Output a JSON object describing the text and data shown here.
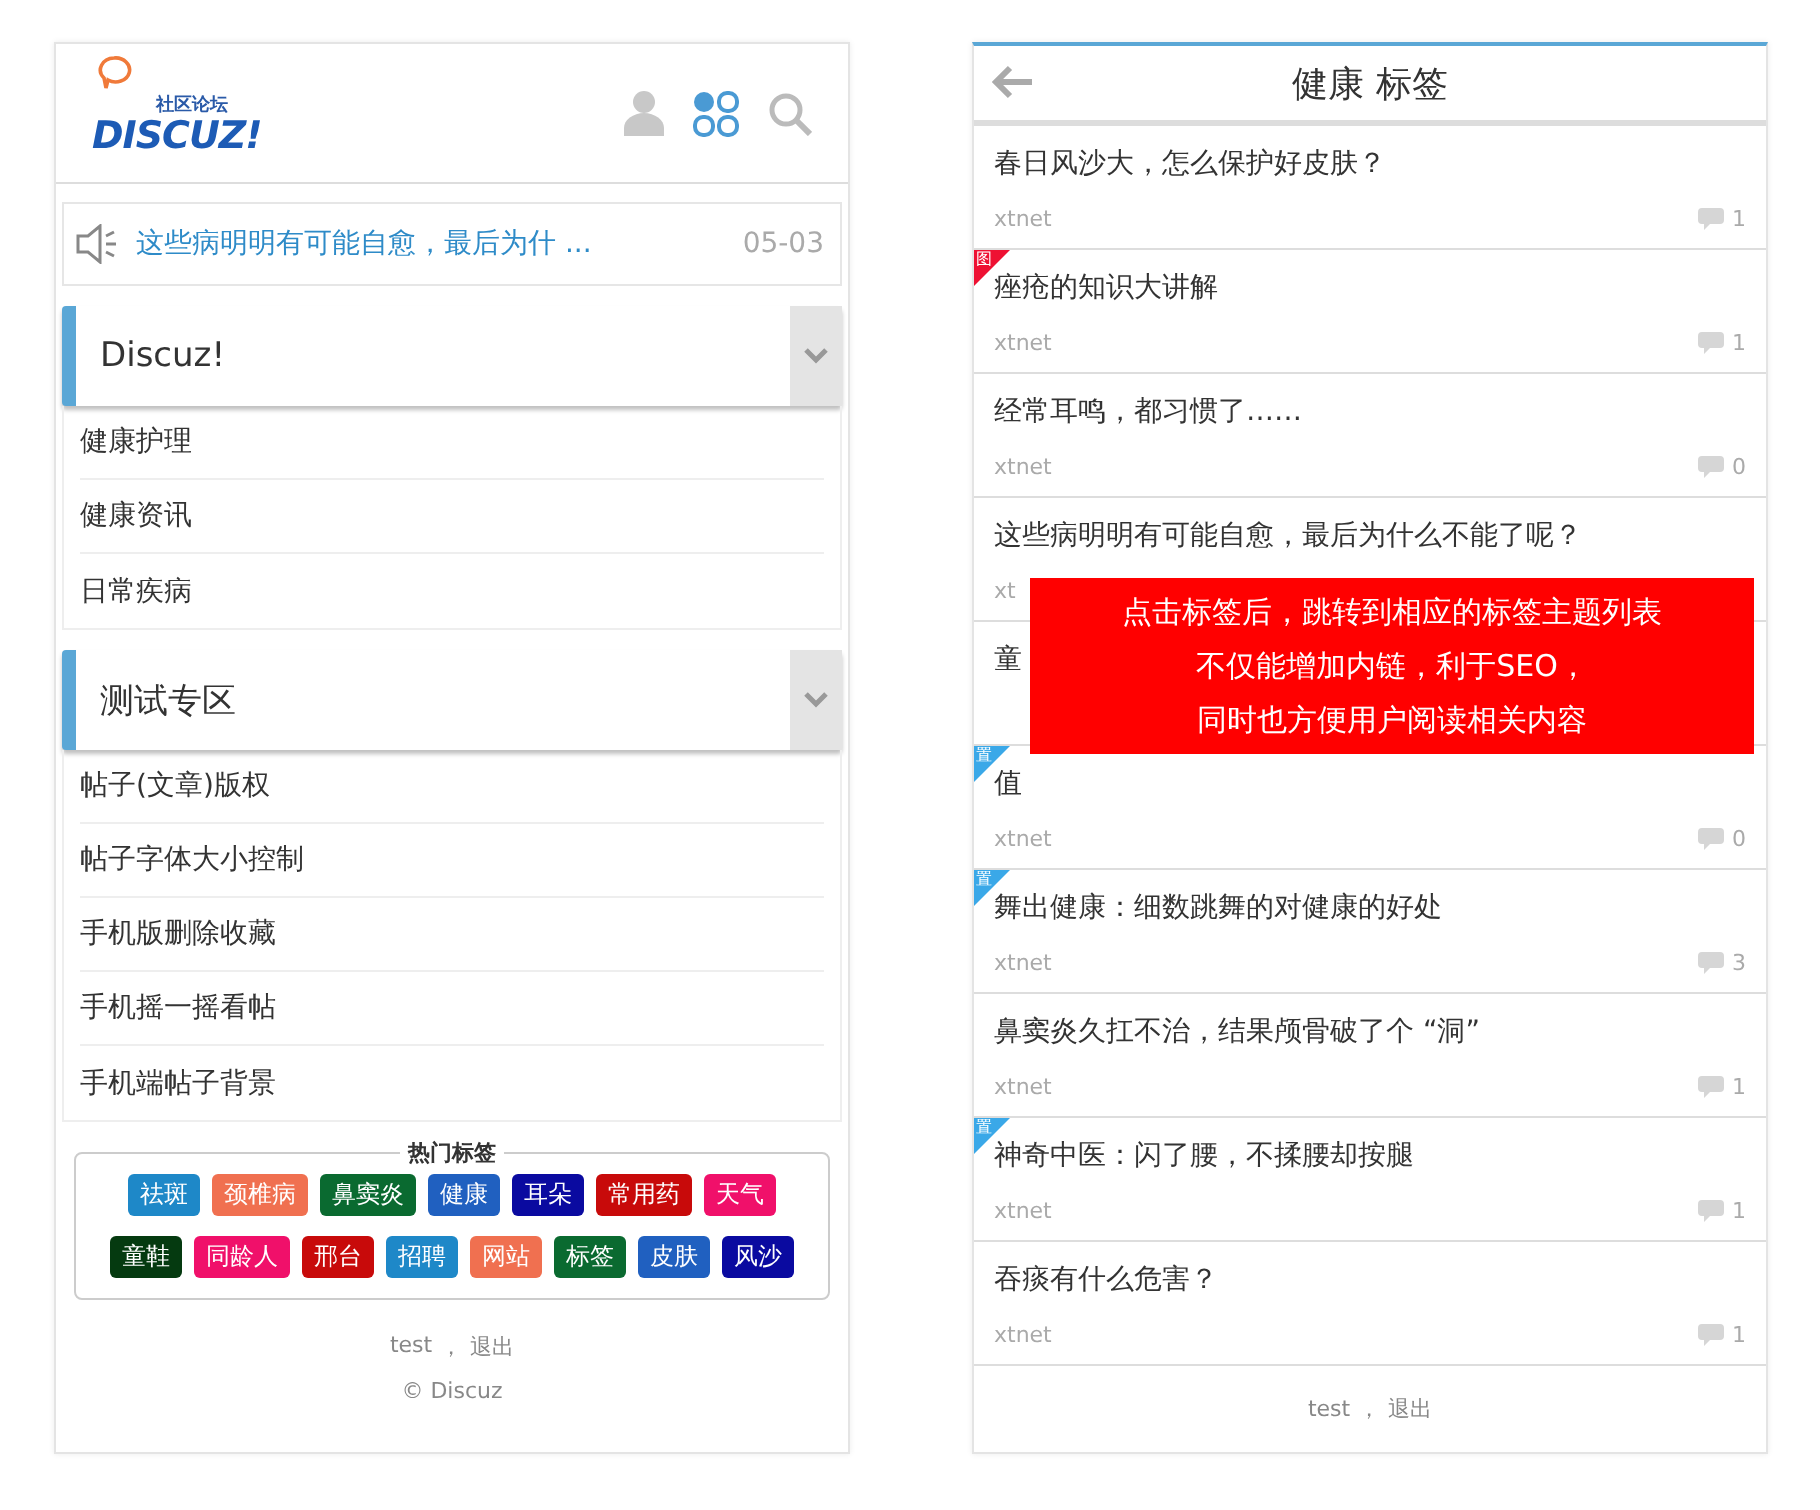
{
  "left": {
    "logo": {
      "tagline": "社区论坛",
      "name": "DISCUZ!"
    },
    "notice": {
      "text": "这些病明明有可能自愈，最后为什 ...",
      "date": "05-03"
    },
    "sections": [
      {
        "title": "Discuz!",
        "expanded": true,
        "items": [
          "健康护理",
          "健康资讯",
          "日常疾病"
        ]
      },
      {
        "title": "测试专区",
        "expanded": true,
        "items": [
          "帖子(文章)版权",
          "帖子字体大小控制",
          "手机版删除收藏",
          "手机摇一摇看帖",
          "手机端帖子背景"
        ]
      }
    ],
    "hot_tags": {
      "title": "热门标签",
      "tags": [
        {
          "label": "祛斑",
          "color": "#1e88c8"
        },
        {
          "label": "颈椎病",
          "color": "#f07050"
        },
        {
          "label": "鼻窦炎",
          "color": "#0a6a30"
        },
        {
          "label": "健康",
          "color": "#2060c0"
        },
        {
          "label": "耳朵",
          "color": "#0a0aa0"
        },
        {
          "label": "常用药",
          "color": "#c80a0a"
        },
        {
          "label": "天气",
          "color": "#f0106a"
        },
        {
          "label": "童鞋",
          "color": "#053a10"
        },
        {
          "label": "同龄人",
          "color": "#f0106a"
        },
        {
          "label": "邢台",
          "color": "#c80a0a"
        },
        {
          "label": "招聘",
          "color": "#1e88c8"
        },
        {
          "label": "网站",
          "color": "#f07050"
        },
        {
          "label": "标签",
          "color": "#0a6a30"
        },
        {
          "label": "皮肤",
          "color": "#2060c0"
        },
        {
          "label": "风沙",
          "color": "#0a0aa0"
        }
      ]
    },
    "footer": {
      "user": "test",
      "separator": "，",
      "logout": "退出",
      "copyright": "© Discuz"
    }
  },
  "right": {
    "title": "健康 标签",
    "threads": [
      {
        "title": "春日风沙大，怎么保护好皮肤？",
        "author": "xtnet",
        "replies": "1"
      },
      {
        "title": "痤疮的知识大讲解",
        "author": "xtnet",
        "replies": "1",
        "badge": {
          "kind": "image",
          "text": "图"
        }
      },
      {
        "title": "经常耳鸣，都习惯了……",
        "author": "xtnet",
        "replies": "0"
      },
      {
        "title": "这些病明明有可能自愈，最后为什么不能了呢？",
        "author": "xt"
      },
      {
        "title": "童"
      },
      {
        "title": "值",
        "author": "xtnet",
        "replies": "0",
        "badge": {
          "kind": "sticky",
          "text": "置"
        }
      },
      {
        "title": "舞出健康：细数跳舞的对健康的好处",
        "author": "xtnet",
        "replies": "3",
        "badge": {
          "kind": "sticky",
          "text": "置"
        }
      },
      {
        "title": "鼻窦炎久扛不治，结果颅骨破了个 “洞”",
        "author": "xtnet",
        "replies": "1"
      },
      {
        "title": "神奇中医：闪了腰，不揉腰却按腿",
        "author": "xtnet",
        "replies": "1",
        "badge": {
          "kind": "sticky",
          "text": "置"
        }
      },
      {
        "title": "吞痰有什么危害？",
        "author": "xtnet",
        "replies": "1"
      }
    ],
    "callout": [
      "点击标签后，跳转到相应的标签主题列表",
      "不仅能增加内链，利于SEO，",
      "同时也方便用户阅读相关内容"
    ],
    "footer": {
      "user": "test",
      "separator": "，",
      "logout": "退出"
    }
  }
}
